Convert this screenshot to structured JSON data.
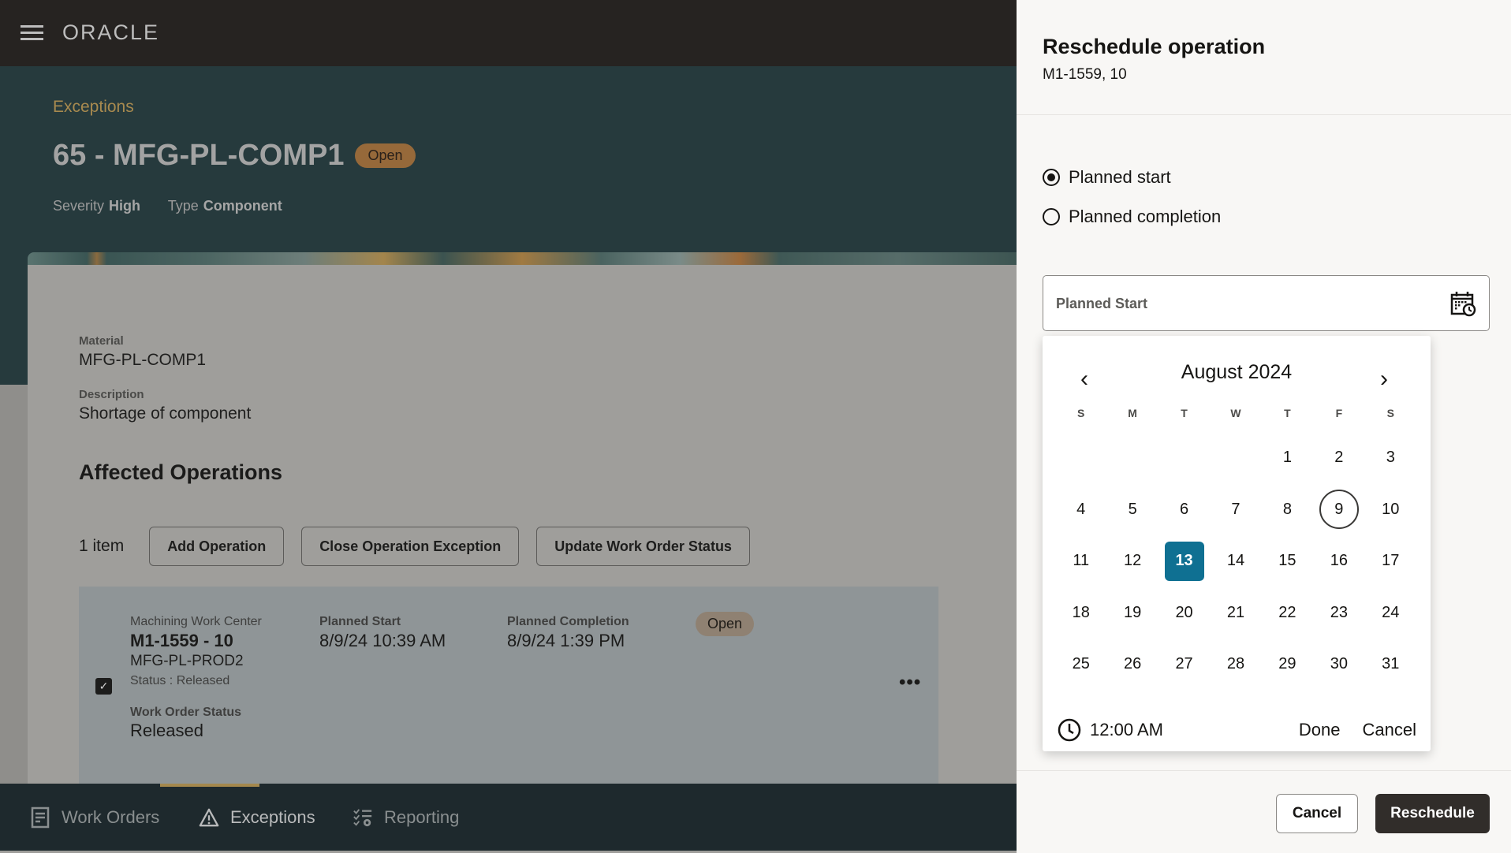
{
  "app": {
    "logo": "ORACLE",
    "breadcrumb": "Exceptions",
    "title": "65 - MFG-PL-COMP1",
    "title_status": "Open",
    "severity_label": "Severity",
    "severity_value": "High",
    "type_label": "Type",
    "type_value": "Component",
    "material_label": "Material",
    "material_value": "MFG-PL-COMP1",
    "description_label": "Description",
    "description_value": "Shortage of component",
    "section_title": "Affected Operations",
    "item_count": "1 item",
    "toolbar": {
      "add_operation": "Add Operation",
      "close_exception": "Close Operation Exception",
      "update_status": "Update Work Order Status"
    },
    "operation": {
      "checked": true,
      "work_center": "Machining Work Center",
      "id": "M1-1559 - 10",
      "item": "MFG-PL-PROD2",
      "status": "Status : Released",
      "planned_start_label": "Planned Start",
      "planned_start_value": "8/9/24 10:39 AM",
      "planned_completion_label": "Planned Completion",
      "planned_completion_value": "8/9/24 1:39 PM",
      "badge": "Open",
      "work_order_status_label": "Work Order Status",
      "work_order_status_value": "Released",
      "more_icon": "ellipsis-icon"
    },
    "bottom_nav": [
      {
        "label": "Work Orders",
        "icon": "document-icon",
        "active": false
      },
      {
        "label": "Exceptions",
        "icon": "warning-icon",
        "active": true
      },
      {
        "label": "Reporting",
        "icon": "checklist-gear-icon",
        "active": false
      }
    ]
  },
  "panel": {
    "title": "Reschedule operation",
    "subtitle": "M1-1559, 10",
    "radios": [
      {
        "label": "Planned start",
        "selected": true
      },
      {
        "label": "Planned completion",
        "selected": false
      }
    ],
    "input_label": "Planned Start",
    "calendar": {
      "month_label": "August 2024",
      "weekdays": [
        "S",
        "M",
        "T",
        "W",
        "T",
        "F",
        "S"
      ],
      "leading_blanks": 4,
      "days_in_month": 31,
      "today": 9,
      "selected": 13,
      "time": "12:00 AM",
      "done": "Done",
      "cancel": "Cancel"
    },
    "cancel_button": "Cancel",
    "reschedule_button": "Reschedule"
  },
  "colors": {
    "accent_selected": "#0f7092",
    "primary_button": "#312d2a",
    "badge_open": "#96693a"
  }
}
